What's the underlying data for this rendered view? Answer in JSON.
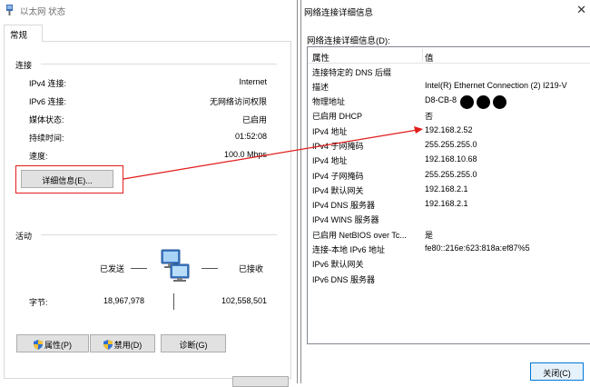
{
  "left_window": {
    "title": "以太网 状态",
    "tab": "常规",
    "connection": {
      "title": "连接",
      "rows": [
        {
          "label": "IPv4 连接:",
          "value": "Internet"
        },
        {
          "label": "IPv6 连接:",
          "value": "无网络访问权限"
        },
        {
          "label": "媒体状态:",
          "value": "已启用"
        },
        {
          "label": "持续时间:",
          "value": "01:52:08"
        },
        {
          "label": "速度:",
          "value": "100.0 Mbps"
        }
      ],
      "details_button": "详细信息(E)..."
    },
    "activity": {
      "title": "活动",
      "sent_label": "已发送",
      "received_label": "已接收",
      "bytes_label": "字节:",
      "bytes_sent": "18,967,978",
      "bytes_received": "102,558,501"
    },
    "buttons": {
      "properties": "属性(P)",
      "disable": "禁用(D)",
      "diagnose": "诊断(G)"
    }
  },
  "right_window": {
    "title": "网络连接详细信息",
    "subtitle": "网络连接详细信息(D):",
    "columns": {
      "property": "属性",
      "value": "值"
    },
    "rows": [
      {
        "property": "连接特定的 DNS 后缀",
        "value": ""
      },
      {
        "property": "描述",
        "value": "Intel(R) Ethernet Connection (2) I219-V"
      },
      {
        "property": "物理地址",
        "value": "D8-CB-8"
      },
      {
        "property": "已启用 DHCP",
        "value": "否"
      },
      {
        "property": "IPv4 地址",
        "value": "192.168.2.52"
      },
      {
        "property": "IPv4 子网掩码",
        "value": "255.255.255.0"
      },
      {
        "property": "IPv4 地址",
        "value": "192.168.10.68"
      },
      {
        "property": "IPv4 子网掩码",
        "value": "255.255.255.0"
      },
      {
        "property": "IPv4 默认网关",
        "value": "192.168.2.1"
      },
      {
        "property": "IPv4 DNS 服务器",
        "value": "192.168.2.1"
      },
      {
        "property": "IPv4 WINS 服务器",
        "value": ""
      },
      {
        "property": "已启用 NetBIOS over Tc...",
        "value": "是"
      },
      {
        "property": "连接-本地 IPv6 地址",
        "value": "fe80::216e:623:818a:ef87%5"
      },
      {
        "property": "IPv6 默认网关",
        "value": ""
      },
      {
        "property": "IPv6 DNS 服务器",
        "value": ""
      }
    ],
    "close_button": "关闭(C)"
  },
  "annotation": {
    "color": "#e21b1b"
  },
  "icons": {
    "network": "network-computers-icon",
    "shield": "uac-shield-icon"
  }
}
